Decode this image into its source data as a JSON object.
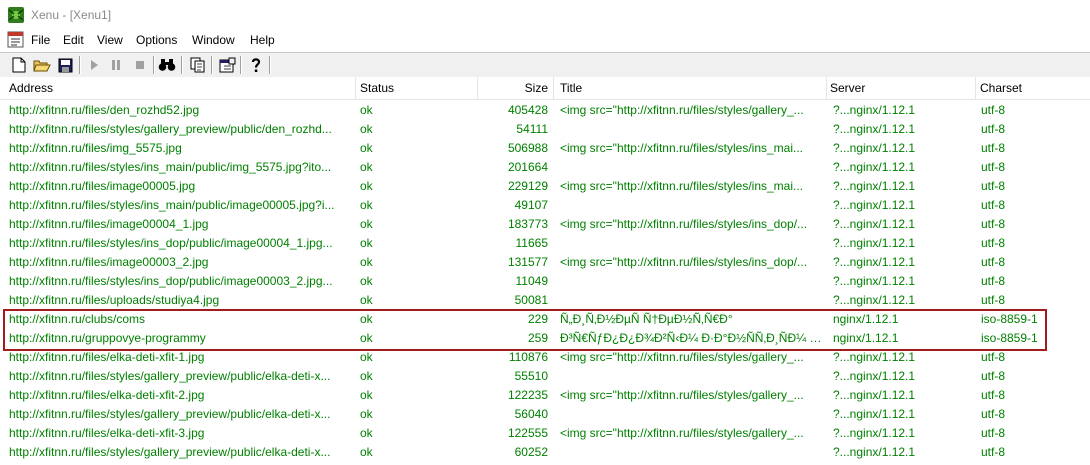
{
  "window": {
    "title": "Xenu - [Xenu1]"
  },
  "menu": [
    "File",
    "Edit",
    "View",
    "Options",
    "Window",
    "Help"
  ],
  "toolbar": {
    "buttons": [
      "new-document",
      "open-folder",
      "save",
      "play",
      "pause",
      "stop",
      "find-binoculars",
      "copy",
      "properties",
      "help"
    ]
  },
  "columns": {
    "address": "Address",
    "status": "Status",
    "size": "Size",
    "title": "Title",
    "server": "Server",
    "charset": "Charset"
  },
  "rows": [
    {
      "address": "http://xfitnn.ru/files/den_rozhd52.jpg",
      "status": "ok",
      "size": "405428",
      "title": "<img src=\"http://xfitnn.ru/files/styles/gallery_...",
      "server": "?...nginx/1.12.1",
      "charset": "utf-8"
    },
    {
      "address": "http://xfitnn.ru/files/styles/gallery_preview/public/den_rozhd...",
      "status": "ok",
      "size": "54111",
      "title": "",
      "server": "?...nginx/1.12.1",
      "charset": "utf-8"
    },
    {
      "address": "http://xfitnn.ru/files/img_5575.jpg",
      "status": "ok",
      "size": "506988",
      "title": "<img src=\"http://xfitnn.ru/files/styles/ins_mai...",
      "server": "?...nginx/1.12.1",
      "charset": "utf-8"
    },
    {
      "address": "http://xfitnn.ru/files/styles/ins_main/public/img_5575.jpg?ito...",
      "status": "ok",
      "size": "201664",
      "title": "",
      "server": "?...nginx/1.12.1",
      "charset": "utf-8"
    },
    {
      "address": "http://xfitnn.ru/files/image00005.jpg",
      "status": "ok",
      "size": "229129",
      "title": "<img src=\"http://xfitnn.ru/files/styles/ins_mai...",
      "server": "?...nginx/1.12.1",
      "charset": "utf-8"
    },
    {
      "address": "http://xfitnn.ru/files/styles/ins_main/public/image00005.jpg?i...",
      "status": "ok",
      "size": "49107",
      "title": "",
      "server": "?...nginx/1.12.1",
      "charset": "utf-8"
    },
    {
      "address": "http://xfitnn.ru/files/image00004_1.jpg",
      "status": "ok",
      "size": "183773",
      "title": "<img src=\"http://xfitnn.ru/files/styles/ins_dop/...",
      "server": "?...nginx/1.12.1",
      "charset": "utf-8"
    },
    {
      "address": "http://xfitnn.ru/files/styles/ins_dop/public/image00004_1.jpg...",
      "status": "ok",
      "size": "11665",
      "title": "",
      "server": "?...nginx/1.12.1",
      "charset": "utf-8"
    },
    {
      "address": "http://xfitnn.ru/files/image00003_2.jpg",
      "status": "ok",
      "size": "131577",
      "title": "<img src=\"http://xfitnn.ru/files/styles/ins_dop/...",
      "server": "?...nginx/1.12.1",
      "charset": "utf-8"
    },
    {
      "address": "http://xfitnn.ru/files/styles/ins_dop/public/image00003_2.jpg...",
      "status": "ok",
      "size": "11049",
      "title": "",
      "server": "?...nginx/1.12.1",
      "charset": "utf-8"
    },
    {
      "address": "http://xfitnn.ru/files/uploads/studiya4.jpg",
      "status": "ok",
      "size": "50081",
      "title": "",
      "server": "?...nginx/1.12.1",
      "charset": "utf-8"
    },
    {
      "address": "http://xfitnn.ru/clubs/coms",
      "status": "ok",
      "size": "229",
      "title": "Ñ„Ð¸Ñ‚Ð½ÐµÑ Ñ†ÐµÐ½Ñ‚Ñ€Ð°",
      "server": "nginx/1.12.1",
      "charset": "iso-8859-1"
    },
    {
      "address": "http://xfitnn.ru/gruppovye-programmy",
      "status": "ok",
      "size": "259",
      "title": "Ð³Ñ€ÑƒÐ¿Ð¿Ð¾Ð²Ñ‹Ð¼ Ð·Ð°Ð½ÑÑ‚Ð¸ÑÐ¼ Ñ...",
      "server": "nginx/1.12.1",
      "charset": "iso-8859-1"
    },
    {
      "address": "http://xfitnn.ru/files/elka-deti-xfit-1.jpg",
      "status": "ok",
      "size": "110876",
      "title": "<img src=\"http://xfitnn.ru/files/styles/gallery_...",
      "server": "?...nginx/1.12.1",
      "charset": "utf-8"
    },
    {
      "address": "http://xfitnn.ru/files/styles/gallery_preview/public/elka-deti-x...",
      "status": "ok",
      "size": "55510",
      "title": "",
      "server": "?...nginx/1.12.1",
      "charset": "utf-8"
    },
    {
      "address": "http://xfitnn.ru/files/elka-deti-xfit-2.jpg",
      "status": "ok",
      "size": "122235",
      "title": "<img src=\"http://xfitnn.ru/files/styles/gallery_...",
      "server": "?...nginx/1.12.1",
      "charset": "utf-8"
    },
    {
      "address": "http://xfitnn.ru/files/styles/gallery_preview/public/elka-deti-x...",
      "status": "ok",
      "size": "56040",
      "title": "",
      "server": "?...nginx/1.12.1",
      "charset": "utf-8"
    },
    {
      "address": "http://xfitnn.ru/files/elka-deti-xfit-3.jpg",
      "status": "ok",
      "size": "122555",
      "title": "<img src=\"http://xfitnn.ru/files/styles/gallery_...",
      "server": "?...nginx/1.12.1",
      "charset": "utf-8"
    },
    {
      "address": "http://xfitnn.ru/files/styles/gallery_preview/public/elka-deti-x...",
      "status": "ok",
      "size": "60252",
      "title": "",
      "server": "?...nginx/1.12.1",
      "charset": "utf-8"
    }
  ],
  "colors": {
    "ok_text": "#008000",
    "highlight_border": "#a31b1b"
  }
}
